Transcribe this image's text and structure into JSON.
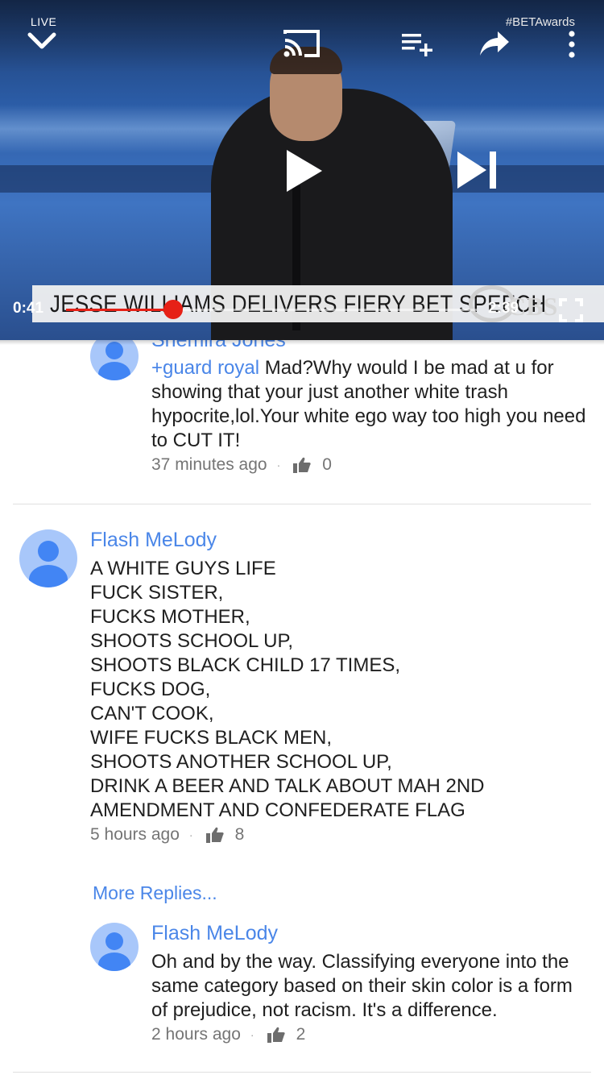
{
  "player": {
    "live_label": "LIVE",
    "hashtag": "#BETAwards",
    "lower_third": "JESSE WILLIAMS DELIVERS FIERY BET SPEECH",
    "network": "CBS",
    "time_current": "0:41",
    "time_total": "2:39",
    "progress": 0.26,
    "colors": {
      "progress": "#e62117"
    }
  },
  "comments": {
    "partial_reply": {
      "author": "Shemira Jones",
      "mention": "+guard royal",
      "text": "Mad?Why would I be mad at u for showing that your just another white trash hypocrite,lol.Your white ego way too high you need to CUT IT!",
      "time": "37 minutes ago",
      "likes": "0"
    },
    "main": {
      "author": "Flash MeLody",
      "lines": [
        "A WHITE GUYS LIFE",
        "FUCK SISTER,",
        "FUCKS MOTHER,",
        "SHOOTS SCHOOL UP,",
        "SHOOTS BLACK CHILD 17 TIMES,",
        "FUCKS DOG,",
        "CAN'T COOK,",
        "WIFE FUCKS BLACK MEN,",
        "SHOOTS ANOTHER SCHOOL UP,",
        "DRINK A BEER AND TALK ABOUT MAH 2ND",
        "AMENDMENT AND CONFEDERATE FLAG"
      ],
      "time": "5 hours ago",
      "likes": "8"
    },
    "more_replies": "More Replies...",
    "reply": {
      "author": "Flash MeLody",
      "text": "Oh and by the way. Classifying everyone into the same category based on their skin color is a form of prejudice, not racism. It's a difference.",
      "time": "2 hours ago",
      "likes": "2"
    },
    "colors": {
      "link": "#4a86e8",
      "avatar_bg": "#a8c7fa",
      "avatar_fg": "#4285f4"
    }
  }
}
